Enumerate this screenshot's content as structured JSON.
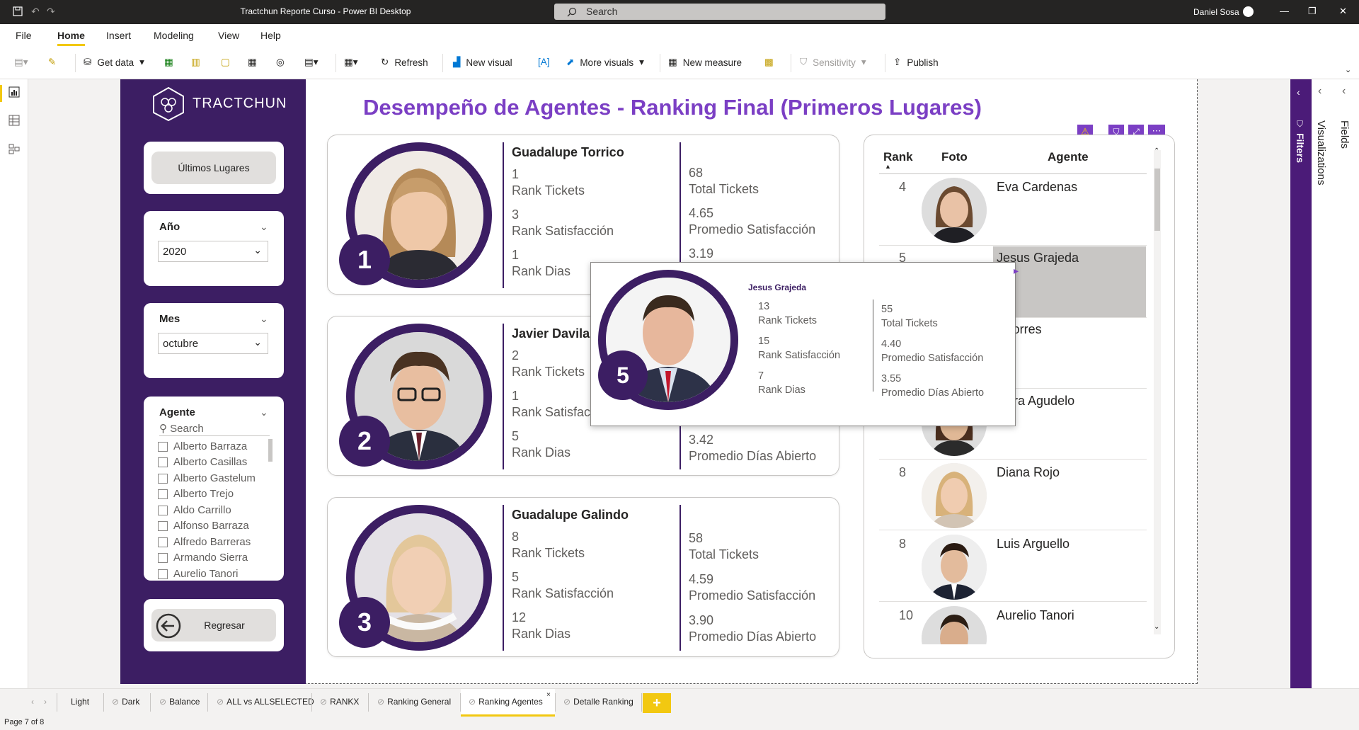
{
  "window": {
    "title": "Tractchun Reporte Curso - Power BI Desktop",
    "search_placeholder": "Search",
    "user": "Daniel Sosa"
  },
  "menu": [
    "File",
    "Home",
    "Insert",
    "Modeling",
    "View",
    "Help"
  ],
  "ribbon": {
    "get_data": "Get data",
    "refresh": "Refresh",
    "new_visual": "New visual",
    "more_visuals": "More visuals",
    "new_measure": "New measure",
    "sensitivity": "Sensitivity",
    "publish": "Publish"
  },
  "brand": "TRACTCHUN",
  "sidebar": {
    "ultimos_button": "Últimos Lugares",
    "year_slicer": {
      "title": "Año",
      "value": "2020"
    },
    "month_slicer": {
      "title": "Mes",
      "value": "octubre"
    },
    "agent_slicer": {
      "title": "Agente",
      "search_placeholder": "Search",
      "items": [
        "Alberto Barraza",
        "Alberto Casillas",
        "Alberto Gastelum",
        "Alberto Trejo",
        "Aldo Carrillo",
        "Alfonso Barraza",
        "Alfredo Barreras",
        "Armando Sierra",
        "Aurelio Tanori"
      ]
    },
    "back_button": "Regresar"
  },
  "report_title": "Desempeño de Agentes - Ranking Final (Primeros Lugares)",
  "labels": {
    "rank_tickets": "Rank Tickets",
    "rank_satisfaccion": "Rank Satisfacción",
    "rank_dias": "Rank Dias",
    "total_tickets": "Total Tickets",
    "promedio_satisfaccion": "Promedio Satisfacción",
    "promedio_dias": "Promedio Días Abierto"
  },
  "top_cards": [
    {
      "position": "1",
      "name": "Guadalupe Torrico",
      "rank_tickets": "1",
      "rank_satisfaccion": "3",
      "rank_dias": "1",
      "total_tickets": "68",
      "promedio_satisfaccion": "4.65",
      "promedio_dias": "3.19"
    },
    {
      "position": "2",
      "name": "Javier Davila",
      "rank_tickets": "2",
      "rank_satisfaccion": "1",
      "rank_dias": "5",
      "total_tickets": "",
      "promedio_satisfaccion": "",
      "promedio_dias": "3.42"
    },
    {
      "position": "3",
      "name": "Guadalupe Galindo",
      "rank_tickets": "8",
      "rank_satisfaccion": "5",
      "rank_dias": "12",
      "total_tickets": "58",
      "promedio_satisfaccion": "4.59",
      "promedio_dias": "3.90"
    }
  ],
  "table": {
    "headers": {
      "rank": "Rank",
      "foto": "Foto",
      "agente": "Agente"
    },
    "rows": [
      {
        "rank": "4",
        "name": "Eva Cardenas"
      },
      {
        "rank": "5",
        "name": "Jesus Grajeda"
      },
      {
        "rank": "",
        "name": "s Torres"
      },
      {
        "rank": "",
        "name": "naira Agudelo"
      },
      {
        "rank": "8",
        "name": "Diana Rojo"
      },
      {
        "rank": "8",
        "name": "Luis Arguello"
      },
      {
        "rank": "10",
        "name": "Aurelio Tanori"
      }
    ]
  },
  "tooltip": {
    "position": "5",
    "name": "Jesus Grajeda",
    "rank_tickets": "13",
    "rank_satisfaccion": "15",
    "rank_dias": "7",
    "total_tickets": "55",
    "promedio_satisfaccion": "4.40",
    "promedio_dias": "3.55"
  },
  "right_panes": {
    "filters": "Filters",
    "visualizations": "Visualizations",
    "fields": "Fields"
  },
  "tabs": [
    "Light",
    "Dark",
    "Balance",
    "ALL vs ALLSELECTED",
    "RANKX",
    "Ranking General",
    "Ranking Agentes",
    "Detalle Ranking"
  ],
  "active_tab": "Ranking Agentes",
  "status": "Page 7 of 8",
  "colors": {
    "purple_dark": "#3c1e63",
    "title_purple": "#7b3fc4",
    "accent_yellow": "#f2c811"
  }
}
